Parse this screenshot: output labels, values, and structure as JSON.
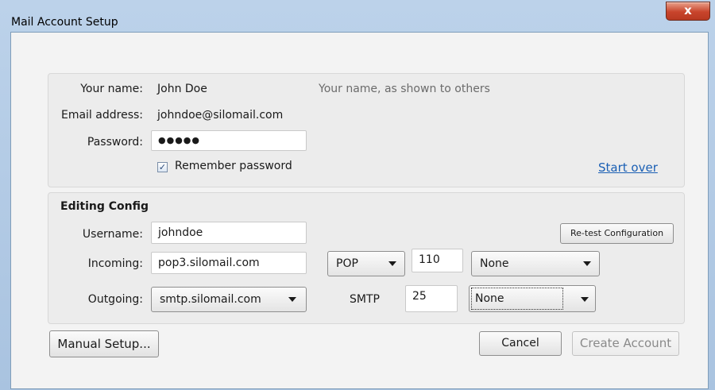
{
  "window": {
    "title": "Mail Account Setup",
    "close_glyph": "x"
  },
  "account": {
    "name_label": "Your name:",
    "name_value": "John Doe",
    "name_hint": "Your name, as shown to others",
    "email_label": "Email address:",
    "email_value": "johndoe@silomail.com",
    "password_label": "Password:",
    "password_value": "●●●●●",
    "remember_label": "Remember password",
    "remember_checked": true,
    "start_over": "Start over"
  },
  "config": {
    "heading": "Editing Config",
    "username_label": "Username:",
    "username_value": "johndoe",
    "retest_label": "Re-test Configuration",
    "incoming_label": "Incoming:",
    "incoming_server": "pop3.silomail.com",
    "incoming_protocol": "POP",
    "incoming_port": "110",
    "incoming_security": "None",
    "outgoing_label": "Outgoing:",
    "outgoing_server": "smtp.silomail.com",
    "outgoing_protocol": "SMTP",
    "outgoing_port": "25",
    "outgoing_security": "None"
  },
  "footer": {
    "manual_setup": "Manual Setup...",
    "cancel": "Cancel",
    "create_account": "Create Account"
  },
  "colors": {
    "titlebar": "#bcd2ea",
    "close_button": "#c8442b",
    "link": "#1a5fb4"
  }
}
